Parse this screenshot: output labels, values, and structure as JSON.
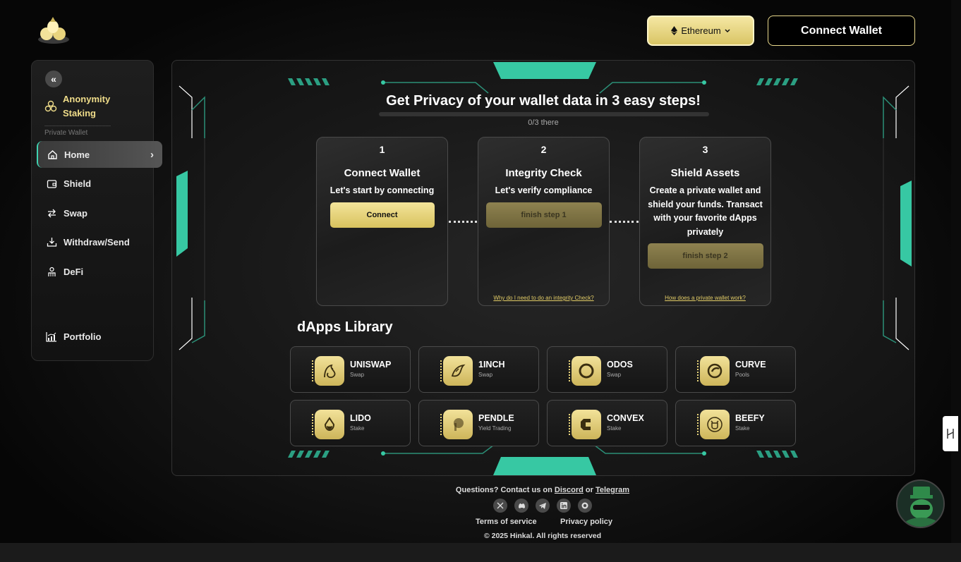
{
  "header": {
    "network_label": "Ethereum",
    "connect_wallet_label": "Connect Wallet"
  },
  "sidebar": {
    "anonymity_staking": "Anonymity Staking",
    "section_label": "Private Wallet",
    "items": [
      {
        "label": "Home",
        "icon": "home-icon",
        "active": true
      },
      {
        "label": "Shield",
        "icon": "wallet-icon"
      },
      {
        "label": "Swap",
        "icon": "swap-icon"
      },
      {
        "label": "Withdraw/Send",
        "icon": "download-icon"
      },
      {
        "label": "DeFi",
        "icon": "defi-icon"
      },
      {
        "label": "Portfolio",
        "icon": "chart-icon"
      }
    ]
  },
  "main": {
    "title": "Get Privacy of your wallet data in 3 easy steps!",
    "progress_text": "0/3 there",
    "progress_fraction": 0,
    "accent_color": "#3fd2b0",
    "gold_color": "#e2cc66",
    "steps": [
      {
        "number": "1",
        "title": "Connect Wallet",
        "description": "Let's start by connecting",
        "button": "Connect",
        "link": ""
      },
      {
        "number": "2",
        "title": "Integrity Check",
        "description": "Let's verify compliance",
        "button": "finish step 1",
        "link": "Why do I need to do an integrity Check?"
      },
      {
        "number": "3",
        "title": "Shield Assets",
        "description": "Create a private wallet and shield your funds. Transact with your favorite dApps privately",
        "button": "finish step 2",
        "link": "How does a private wallet work?"
      }
    ],
    "library_title": "dApps Library",
    "dapps": [
      {
        "name": "UNISWAP",
        "category": "Swap",
        "icon": "uniswap-icon"
      },
      {
        "name": "1INCH",
        "category": "Swap",
        "icon": "1inch-icon"
      },
      {
        "name": "ODOS",
        "category": "Swap",
        "icon": "odos-icon"
      },
      {
        "name": "CURVE",
        "category": "Pools",
        "icon": "curve-icon"
      },
      {
        "name": "LIDO",
        "category": "Stake",
        "icon": "lido-icon"
      },
      {
        "name": "PENDLE",
        "category": "Yield Trading",
        "icon": "pendle-icon"
      },
      {
        "name": "CONVEX",
        "category": "Stake",
        "icon": "convex-icon"
      },
      {
        "name": "BEEFY",
        "category": "Stake",
        "icon": "beefy-icon"
      }
    ]
  },
  "footer": {
    "contact_prefix": "Questions? Contact us on",
    "discord": "Discord",
    "or": "or",
    "telegram": "Telegram",
    "socials": [
      "x-icon",
      "discord-icon",
      "telegram-icon",
      "linkedin-icon",
      "medium-icon"
    ],
    "terms": "Terms of service",
    "privacy": "Privacy policy",
    "copyright": "© 2025 Hinkal. All rights reserved"
  }
}
